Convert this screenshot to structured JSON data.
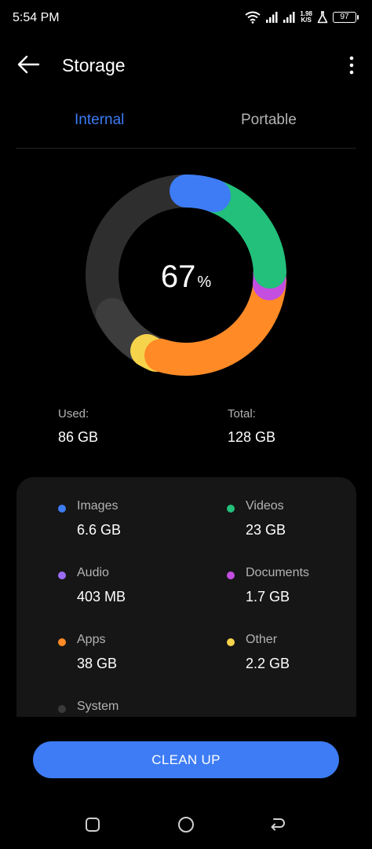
{
  "status_bar": {
    "time": "5:54 PM",
    "net_speed_value": "1.98",
    "net_speed_unit": "K/S",
    "battery": "97",
    "icons": [
      "wifi-icon",
      "signal-icon",
      "signal-icon",
      "flask-icon",
      "battery-icon"
    ]
  },
  "header": {
    "title": "Storage",
    "back_icon": "arrow-left-icon",
    "menu_icon": "more-vertical-icon"
  },
  "tabs": [
    {
      "label": "Internal",
      "selected": true
    },
    {
      "label": "Portable",
      "selected": false
    }
  ],
  "usage": {
    "percent": "67",
    "percent_sign": "%",
    "used_label": "Used:",
    "used_value": "86 GB",
    "total_label": "Total:",
    "total_value": "128 GB"
  },
  "categories": [
    {
      "name": "Images",
      "value": "6.6 GB",
      "color": "#3d7cf5"
    },
    {
      "name": "Videos",
      "value": "23 GB",
      "color": "#22c07a"
    },
    {
      "name": "Audio",
      "value": "403 MB",
      "color": "#9b6cf5"
    },
    {
      "name": "Documents",
      "value": "1.7 GB",
      "color": "#c34ee0"
    },
    {
      "name": "Apps",
      "value": "38 GB",
      "color": "#ff8a26"
    },
    {
      "name": "Other",
      "value": "2.2 GB",
      "color": "#f5d34b"
    },
    {
      "name": "System",
      "value": "",
      "color": "#3a3a3a"
    }
  ],
  "colors": {
    "accent": "#3d7cf5",
    "background": "#000000",
    "card": "#161616",
    "track": "#2e2e2e"
  },
  "actions": {
    "cleanup_label": "CLEAN UP"
  },
  "nav": {
    "recent_icon": "square-icon",
    "home_icon": "circle-icon",
    "back_icon": "return-icon"
  }
}
